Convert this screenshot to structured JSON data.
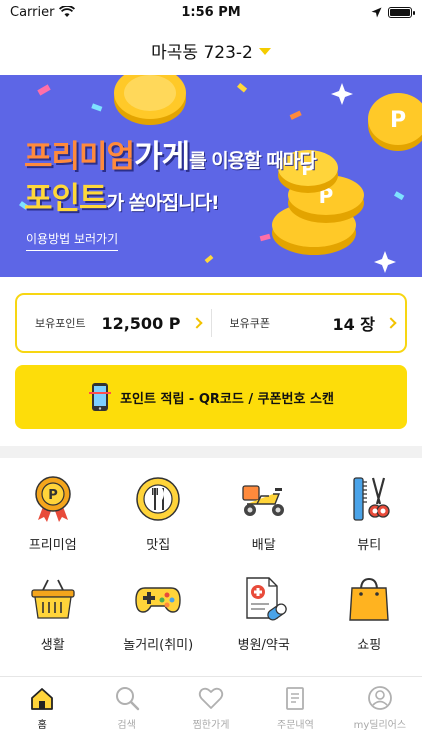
{
  "status_bar": {
    "carrier": "Carrier",
    "time": "1:56 PM",
    "icons": [
      "wifi-icon",
      "location-arrow-icon",
      "battery-icon"
    ]
  },
  "header": {
    "location": "마곡동 723-2",
    "dropdown_icon": "caret-down-icon",
    "accent_color": "#f4cc00"
  },
  "banner": {
    "line1_highlight": "프리미엄",
    "line1_word": "가게",
    "line1_rest": "를 이용할 때마다",
    "line2_highlight": "포인트",
    "line2_rest": "가 쏟아집니다!",
    "link_text": "이용방법 보러가기",
    "background_color": "#5d66e6",
    "coin_letter": "P"
  },
  "points": {
    "points_label": "보유포인트",
    "points_value": "12,500 P",
    "coupons_label": "보유쿠폰",
    "coupons_value": "14 장",
    "border_color": "#f7d612"
  },
  "scan_button": {
    "label": "포인트 적립 - QR코드 / 쿠폰번호 스캔",
    "icon": "phone-scan-icon",
    "color": "#fddd0a"
  },
  "categories": [
    {
      "label": "프리미엄",
      "icon": "premium-badge-icon"
    },
    {
      "label": "맛집",
      "icon": "dining-plate-icon"
    },
    {
      "label": "배달",
      "icon": "delivery-scooter-icon"
    },
    {
      "label": "뷰티",
      "icon": "beauty-comb-scissors-icon"
    },
    {
      "label": "생활",
      "icon": "basket-icon"
    },
    {
      "label": "놀거리(취미)",
      "icon": "gamepad-icon"
    },
    {
      "label": "병원/약국",
      "icon": "medical-pill-icon"
    },
    {
      "label": "쇼핑",
      "icon": "shopping-bag-icon"
    }
  ],
  "tabbar": {
    "active_index": 0,
    "tabs": [
      {
        "label": "홈",
        "icon": "home-icon"
      },
      {
        "label": "검색",
        "icon": "search-icon"
      },
      {
        "label": "찜한가게",
        "icon": "heart-icon"
      },
      {
        "label": "주문내역",
        "icon": "receipt-icon"
      },
      {
        "label": "my딜리어스",
        "icon": "user-icon"
      }
    ]
  }
}
